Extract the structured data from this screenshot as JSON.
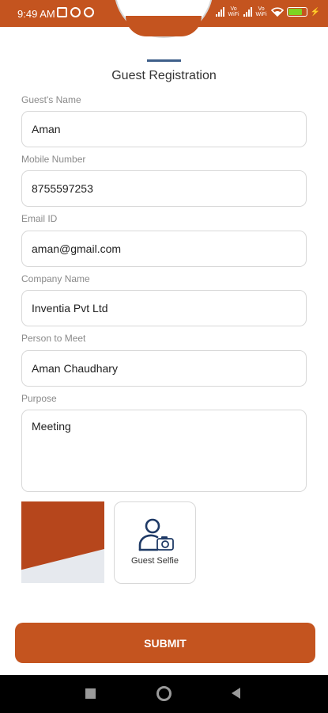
{
  "status_bar": {
    "time": "9:49 AM",
    "left_icons": [
      "wifi-off-icon",
      "app-icon-p",
      "app-icon-t"
    ],
    "right_icons": [
      "signal-icon",
      "volte-icon",
      "signal-icon",
      "vowifi-icon",
      "wifi-icon",
      "battery-icon",
      "charging-icon"
    ],
    "volte_label_1": "Vo\nWiFi",
    "volte_label_2": "Vo\nWiFi",
    "battery_level": 0.78,
    "bar_color": "#c4541f"
  },
  "header": {
    "title": "Guest Registration"
  },
  "form": {
    "guest_name_label": "Guest's Name",
    "guest_name_value": "Aman",
    "mobile_label": "Mobile Number",
    "mobile_value": "8755597253",
    "email_label": "Email ID",
    "email_value": "aman@gmail.com",
    "company_label": "Company Name",
    "company_value": "Inventia Pvt Ltd",
    "person_label": "Person to Meet",
    "person_value": "Aman Chaudhary",
    "purpose_label": "Purpose",
    "purpose_value": "Meeting"
  },
  "selfie": {
    "label": "Guest Selfie",
    "icon": "user-camera-icon"
  },
  "submit": {
    "label": "SUBMIT",
    "color": "#c4541f"
  },
  "nav_bar": {
    "buttons": [
      "recents-icon",
      "home-icon",
      "back-icon"
    ]
  }
}
